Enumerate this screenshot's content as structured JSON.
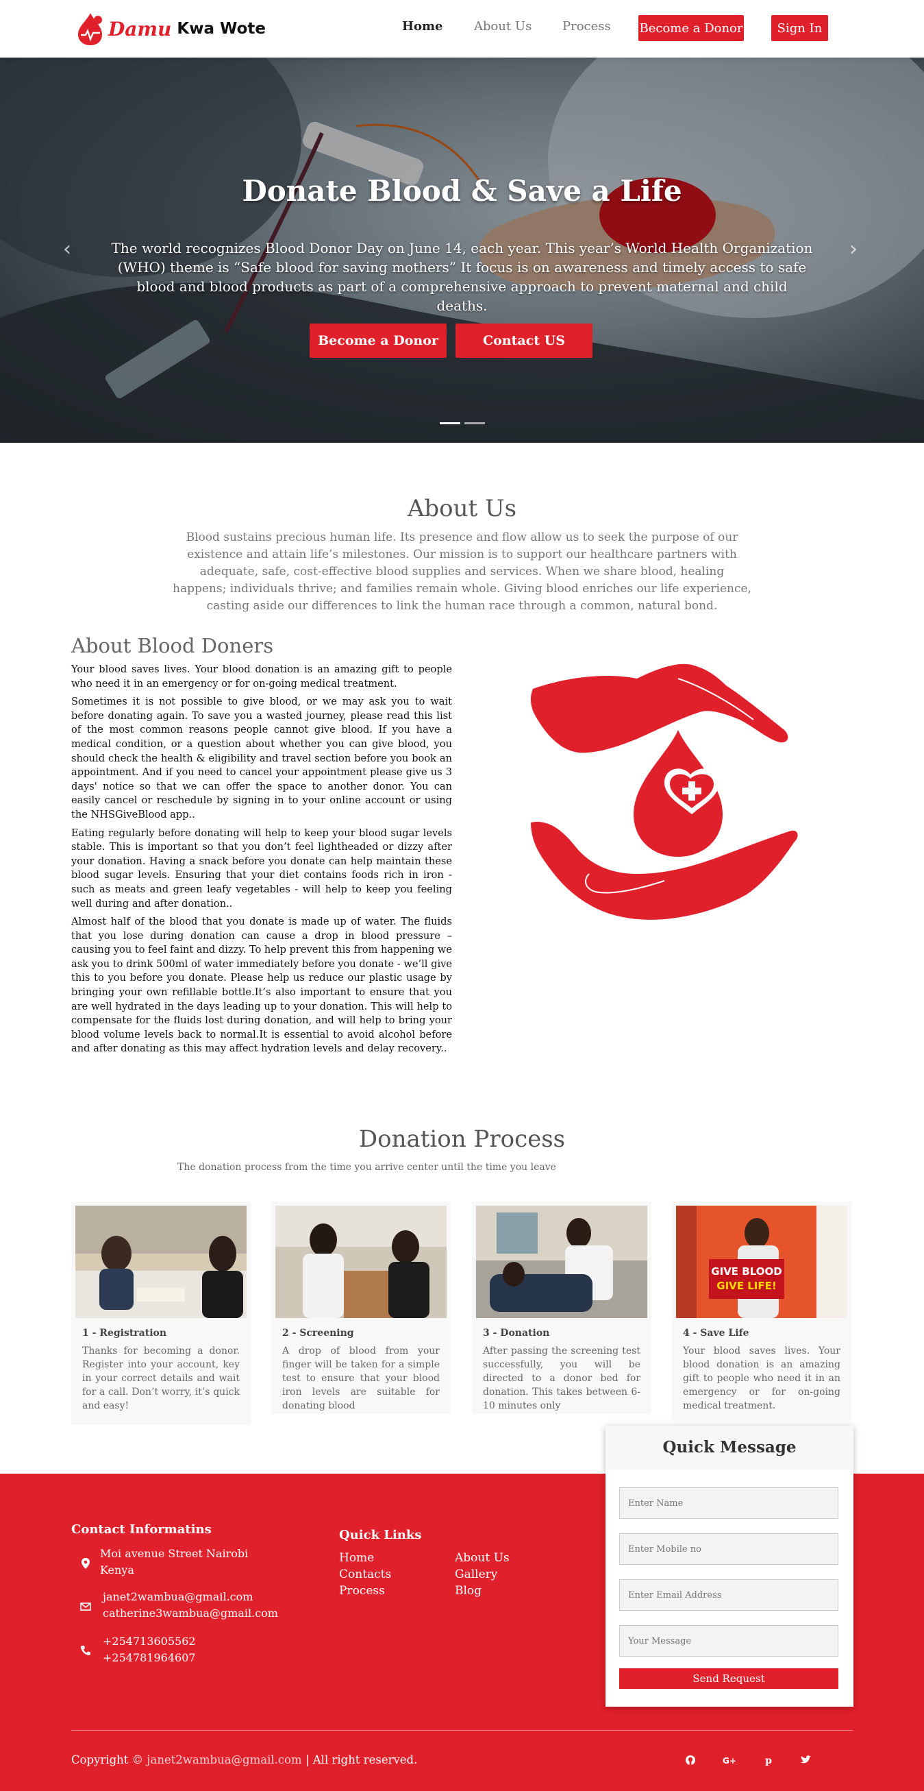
{
  "brand": {
    "name_italic": "Damu",
    "name_rest": "Kwa Wote"
  },
  "nav": {
    "home": "Home",
    "about": "About Us",
    "process": "Process",
    "donor_btn": "Become a Donor",
    "signin_btn": "Sign In"
  },
  "hero": {
    "title": "Donate Blood & Save a Life",
    "text": "The world recognizes Blood Donor Day on June 14, each year. This year’s World Health Organization (WHO) theme is “Safe blood for saving mothers” It focus is on awareness and timely access to safe blood and blood products as part of a comprehensive approach to prevent maternal and child deaths.",
    "donor_btn": "Become a Donor",
    "contact_btn": "Contact US",
    "prev_arrow": "‹",
    "next_arrow": "›"
  },
  "about": {
    "title": "About Us",
    "text": "Blood sustains precious human life. Its presence and flow allow us to seek the purpose of our existence and attain life’s milestones. Our mission is to support our healthcare partners with adequate, safe, cost-effective blood supplies and services. When we share blood, healing happens; individuals thrive; and families remain whole. Giving blood enriches our life experience, casting aside our differences to link the human race through a common, natural bond."
  },
  "donors": {
    "title": "About Blood Doners",
    "p1": "Your blood saves lives. Your blood donation is an amazing gift to people who need it in an emergency or for on-going medical treatment.",
    "p2": "Sometimes it is not possible to give blood, or we may ask you to wait before donating again. To save you a wasted journey, please read this list of the most common reasons people cannot give blood. If you have a medical condition, or a question about whether you can give blood, you should check the health & eligibility and travel section before you book an appointment. And if you need to cancel your appointment please give us 3 days' notice so that we can offer the space to another donor. You can easily cancel or reschedule by signing in to your online account or using the NHSGiveBlood app..",
    "p3": "Eating regularly before donating will help to keep your blood sugar levels stable. This is important so that you don’t feel lightheaded or dizzy after your donation. Having a snack before you donate can help maintain these blood sugar levels. Ensuring that your diet contains foods rich in iron - such as meats and green leafy vegetables - will help to keep you feeling well during and after donation..",
    "p4": "Almost half of the blood that you donate is made up of water. The fluids that you lose during donation can cause a drop in blood pressure – causing you to feel faint and dizzy. To help prevent this from happening we ask you to drink 500ml of water immediately before you donate - we’ll give this to you before you donate. Please help us reduce our plastic usage by bringing your own refillable bottle.It’s also important to ensure that you are well hydrated in the days leading up to your donation. This will help to compensate for the fluids lost during donation, and will help to bring your blood volume levels back to normal.It is essential to avoid alcohol before and after donating as this may affect hydration levels and delay recovery.."
  },
  "process": {
    "title": "Donation Process",
    "subtitle": "The donation process from the time you arrive center until the time you leave",
    "steps": [
      {
        "head": "1 - Registration",
        "body": "Thanks for becoming a donor. Register into your account, key in your correct details and wait for a call. Don’t worry, it’s quick and easy!"
      },
      {
        "head": "2 - Screening",
        "body": "A drop of blood from your finger will be taken for a simple test to ensure that your blood iron levels are suitable for donating blood"
      },
      {
        "head": "3 - Donation",
        "body": "After passing the screening test successfully, you will be directed to a donor bed for donation. This takes between 6-10 minutes only"
      },
      {
        "head": "4 - Save Life",
        "body": "Your blood saves lives. Your blood donation is an amazing gift to people who need it in an emergency or for on-going medical treatment."
      }
    ],
    "sign_line1": "GIVE BLOOD",
    "sign_line2": "GIVE LIFE!"
  },
  "footer": {
    "contact_head": "Contact Informatins",
    "address1": "Moi avenue Street Nairobi",
    "address2": "Kenya",
    "email1": "janet2wambua@gmail.com",
    "email2": "catherine3wambua@gmail.com",
    "phone1": "+254713605562",
    "phone2": "+254781964607",
    "links_head": "Quick Links",
    "links": [
      "Home",
      "Contacts",
      "Process",
      "About Us",
      "Gallery",
      "Blog"
    ],
    "copyright_prefix": "Copyright ©",
    "copyright_email": "janet2wambua@gmail.com",
    "copyright_suffix": "| All right reserved."
  },
  "quick_message": {
    "title": "Quick Message",
    "name_placeholder": "Enter Name",
    "mobile_placeholder": "Enter Mobile no",
    "email_placeholder": "Enter Email Address",
    "message_placeholder": "Your Message",
    "send": "Send Request"
  },
  "colors": {
    "primary": "#e0202b",
    "dark": "#333333"
  },
  "icons": [
    "map-marker-icon",
    "envelope-icon",
    "phone-icon",
    "github-icon",
    "google-plus-icon",
    "pinterest-icon",
    "twitter-icon"
  ]
}
